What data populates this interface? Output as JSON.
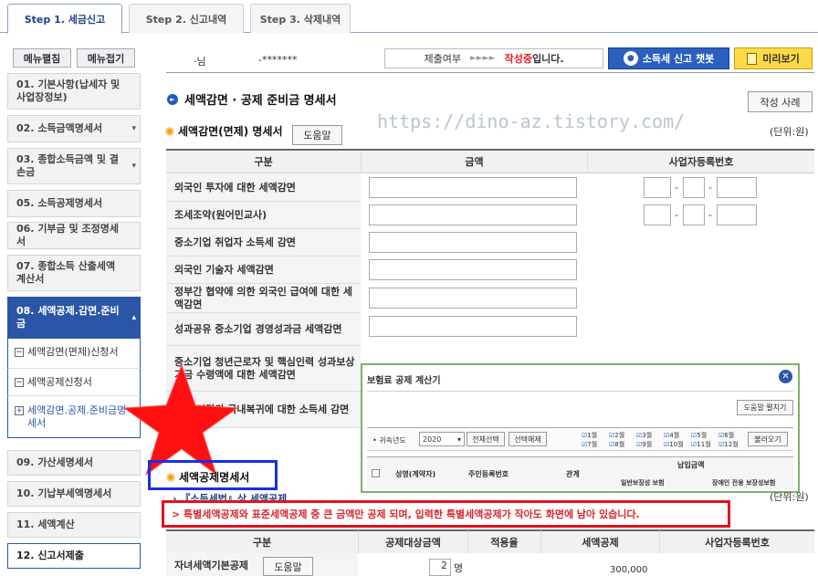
{
  "tabs": [
    {
      "label": "Step 1. 세금신고"
    },
    {
      "label": "Step 2. 신고내역"
    },
    {
      "label": "Step 3. 삭제내역"
    }
  ],
  "sidebar": {
    "menu_edit": "메뉴펼침",
    "menu_collapse": "메뉴접기",
    "items": [
      {
        "label": "01. 기본사항(납세자 및 사업장정보)"
      },
      {
        "label": "02. 소득금액명세서"
      },
      {
        "label": "03. 종합소득금액 및 결손금"
      },
      {
        "label": "05. 소득공제명세서"
      },
      {
        "label": "06. 기부금 및 조정명세서"
      },
      {
        "label": "07. 종합소득 산출세액계산서"
      },
      {
        "label": "08. 세액공제.감면.준비금"
      },
      {
        "label": "09. 가산세명세서"
      },
      {
        "label": "10. 기납부세액명세서"
      },
      {
        "label": "11. 세액계산"
      },
      {
        "label": "12. 신고서제출"
      }
    ],
    "subitems": [
      {
        "label": "세액감면(면제)신청서"
      },
      {
        "label": "세액공제신청서"
      },
      {
        "label": "세액감면.공제.준비금명세서"
      }
    ]
  },
  "header": {
    "user_suffix": "·님",
    "masked_id": "-*******",
    "submit_label": "제출여부",
    "arrows": "►►►►",
    "status": "작성중",
    "status_suffix": "입니다.",
    "chatbot_button": "소득세 신고 챗봇",
    "preview_button": "미리보기"
  },
  "main": {
    "title": "세액감면 · 공제 준비금 명세서",
    "example_button": "작성 사례",
    "watermark": "https://dino-az.tistory.com/",
    "section1_title": "세액감면(면제) 명세서",
    "help_button": "도움말",
    "unit": "(단위:원)",
    "columns": [
      "구분",
      "금액",
      "사업자등록번호"
    ],
    "rows": [
      {
        "label": "외국인 투자에 대한 세액감면"
      },
      {
        "label": "조세조약(원어민교사)"
      },
      {
        "label": "중소기업 취업자 소득세 감면"
      },
      {
        "label": "외국인 기술자 세액감면"
      },
      {
        "label": "정부간 협약에 의한 외국인 급여에 대한 세액감면"
      },
      {
        "label": "성과공유 중소기업 경영성과금 세액감면"
      },
      {
        "label": "중소기업 청년근로자 및 핵심인력 성과보상기금 수령액에 대한 세액감면"
      },
      {
        "label": "우수 인력의 국내복귀에 대한 소득세 감면"
      }
    ],
    "section2_title": "세액공제명세서",
    "sub_link": "『소득세법』상 세액공제",
    "unit2": "(단위:원)",
    "notice": "> 특별세액공제와 표준세액공제 중 큰 금액만 공제 되며, 입력한 특별세액공제가 작아도 화면에 남아 있습니다.",
    "bottom_columns": [
      "구분",
      "공제대상금액",
      "적용율",
      "세액공제",
      "사업자등록번호"
    ],
    "bottom_row": {
      "label": "자녀세액기본공제",
      "help": "도움말",
      "count": "2",
      "count_unit": "명",
      "amount": "300,000"
    }
  },
  "popup": {
    "title": "보험료 공제 계산기",
    "help_button": "도움말 펼치기",
    "year_label": "• 귀속년도",
    "year": "2020",
    "select_all": "전체선택",
    "deselect": "선택해제",
    "months": [
      "1월",
      "2월",
      "3월",
      "4월",
      "5월",
      "6월",
      "7월",
      "8월",
      "9월",
      "10월",
      "11월",
      "12월"
    ],
    "load_button": "불러오기",
    "columns": [
      "성명(계약자)",
      "주민등록번호",
      "관계",
      "납입금액"
    ],
    "sub_columns": [
      "일반보장성 보험",
      "장애인 전용 보장성보험"
    ]
  }
}
